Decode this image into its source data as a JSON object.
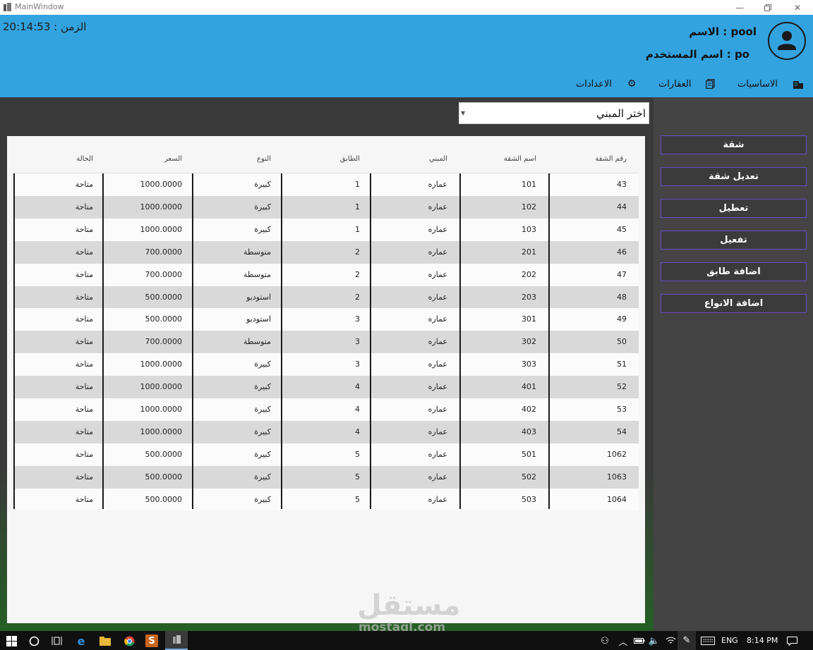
{
  "window": {
    "title": "MainWindow"
  },
  "header": {
    "clock": "الزمن : 20:14:53",
    "user_name": "الاسم : pool",
    "user_login": "اسم المستخدم : po",
    "menu": [
      {
        "label": "الاساسيات",
        "icon": "buildings-icon"
      },
      {
        "label": "العقارات",
        "icon": "documents-icon"
      },
      {
        "label": "الاعدادات",
        "icon": "gear-icon"
      }
    ]
  },
  "combo": {
    "selected": "اختر المبني"
  },
  "sidebar": {
    "buttons": [
      "شقة",
      "تعديل شقة",
      "تعطيل",
      "تفعيل",
      "اضافة طابق",
      "اضافة الانواع"
    ]
  },
  "table": {
    "headers": [
      "رقم الشقة",
      "اسم الشقة",
      "المبني",
      "الطابق",
      "النوع",
      "السعر",
      "الحالة"
    ],
    "rows": [
      [
        "43",
        "101",
        "عماره",
        "1",
        "كبيرة",
        "1000.0000",
        "متاحة"
      ],
      [
        "44",
        "102",
        "عماره",
        "1",
        "كبيرة",
        "1000.0000",
        "متاحة"
      ],
      [
        "45",
        "103",
        "عماره",
        "1",
        "كبيرة",
        "1000.0000",
        "متاحة"
      ],
      [
        "46",
        "201",
        "عماره",
        "2",
        "متوسطة",
        "700.0000",
        "متاحة"
      ],
      [
        "47",
        "202",
        "عماره",
        "2",
        "متوسطة",
        "700.0000",
        "متاحة"
      ],
      [
        "48",
        "203",
        "عماره",
        "2",
        "استوديو",
        "500.0000",
        "متاحة"
      ],
      [
        "49",
        "301",
        "عماره",
        "3",
        "استوديو",
        "500.0000",
        "متاحة"
      ],
      [
        "50",
        "302",
        "عماره",
        "3",
        "متوسطة",
        "700.0000",
        "متاحة"
      ],
      [
        "51",
        "303",
        "عماره",
        "3",
        "كبيرة",
        "1000.0000",
        "متاحة"
      ],
      [
        "52",
        "401",
        "عماره",
        "4",
        "كبيرة",
        "1000.0000",
        "متاحة"
      ],
      [
        "53",
        "402",
        "عماره",
        "4",
        "كبيرة",
        "1000.0000",
        "متاحة"
      ],
      [
        "54",
        "403",
        "عماره",
        "4",
        "كبيرة",
        "1000.0000",
        "متاحة"
      ],
      [
        "1062",
        "501",
        "عماره",
        "5",
        "كبيرة",
        "500.0000",
        "متاحة"
      ],
      [
        "1063",
        "502",
        "عماره",
        "5",
        "كبيرة",
        "500.0000",
        "متاحة"
      ],
      [
        "1064",
        "503",
        "عماره",
        "5",
        "كبيرة",
        "500.0000",
        "متاحة"
      ]
    ]
  },
  "watermark": {
    "arabic": "مستقل",
    "latin": "mostaql.com"
  },
  "taskbar": {
    "language": "ENG",
    "time": "8:14 PM"
  },
  "colors": {
    "header": "#33a3e0",
    "sidebar": "#444444",
    "button_border": "#6b4bc8",
    "row_alt": "#d9d9d9"
  }
}
